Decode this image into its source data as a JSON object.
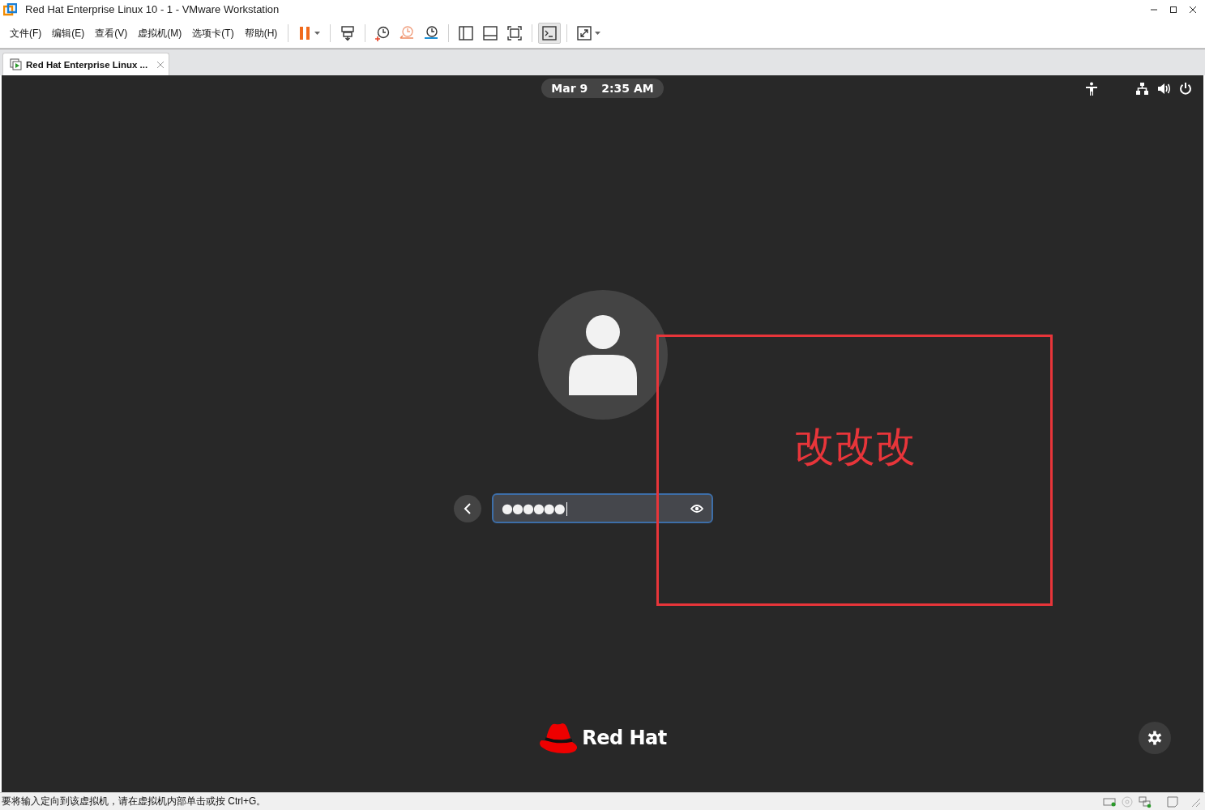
{
  "window": {
    "title": "Red Hat Enterprise Linux 10 - 1 - VMware Workstation"
  },
  "menu": [
    {
      "label": "文件(F)"
    },
    {
      "label": "编辑(E)"
    },
    {
      "label": "查看(V)"
    },
    {
      "label": "虚拟机(M)"
    },
    {
      "label": "选项卡(T)"
    },
    {
      "label": "帮助(H)"
    }
  ],
  "toolbar": {
    "console_selected": true
  },
  "tabs": [
    {
      "label": "Red Hat Enterprise Linux ...",
      "selected": true
    }
  ],
  "guest": {
    "date": "Mar 9",
    "time": "2:35 AM",
    "password": {
      "value": "●●●●●●",
      "focused": true
    },
    "logo_text": "Red Hat"
  },
  "annotation": {
    "text": "改改改",
    "color": "#e8353a"
  },
  "status_bar": {
    "message": "要将输入定向到该虚拟机，请在虚拟机内部单击或按 Ctrl+G。"
  }
}
